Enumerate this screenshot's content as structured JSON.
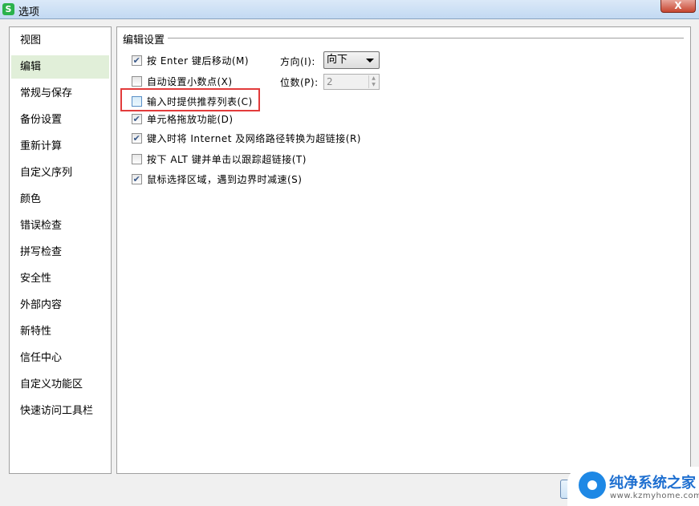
{
  "window": {
    "title": "选项",
    "app_icon": "S",
    "close": "X"
  },
  "sidebar": {
    "items": [
      {
        "label": "视图"
      },
      {
        "label": "编辑",
        "selected": true
      },
      {
        "label": "常规与保存"
      },
      {
        "label": "备份设置"
      },
      {
        "label": "重新计算"
      },
      {
        "label": "自定义序列"
      },
      {
        "label": "颜色"
      },
      {
        "label": "错误检查"
      },
      {
        "label": "拼写检查"
      },
      {
        "label": "安全性"
      },
      {
        "label": "外部内容"
      },
      {
        "label": "新特性"
      },
      {
        "label": "信任中心"
      },
      {
        "label": "自定义功能区"
      },
      {
        "label": "快速访问工具栏"
      }
    ]
  },
  "main": {
    "section_title": "编辑设置",
    "options": [
      {
        "label": "按 Enter 键后移动(M)",
        "checked": true
      },
      {
        "label": "自动设置小数点(X)",
        "checked": false
      },
      {
        "label": "输入时提供推荐列表(C)",
        "checked": false,
        "highlighted": true
      },
      {
        "label": "单元格拖放功能(D)",
        "checked": true
      },
      {
        "label": "键入时将 Internet 及网络路径转换为超链接(R)",
        "checked": true
      },
      {
        "label": "按下 ALT 键并单击以跟踪超链接(T)",
        "checked": false
      },
      {
        "label": "鼠标选择区域，遇到边界时减速(S)",
        "checked": true
      }
    ],
    "direction_label": "方向(I):",
    "direction_value": "向下",
    "digits_label": "位数(P):",
    "digits_value": "2"
  },
  "watermark": {
    "name": "纯净系统之家",
    "url": "www.kzmyhome.com"
  },
  "colors": {
    "selected_bg": "#e1efd9",
    "highlight_border": "#e23b3b",
    "brand": "#2bb24c"
  }
}
